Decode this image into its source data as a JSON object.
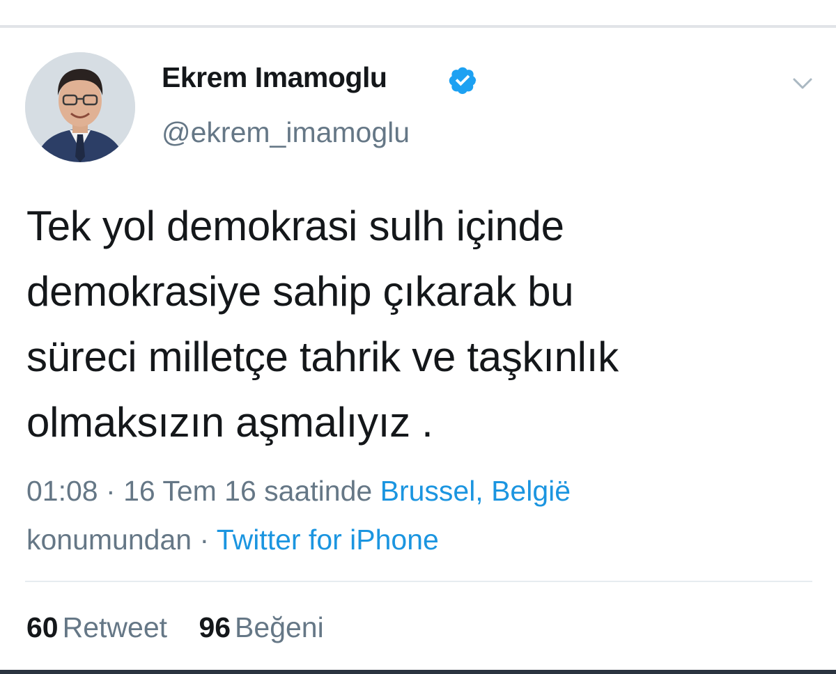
{
  "user": {
    "display_name": "Ekrem Imamoglu",
    "handle": "@ekrem_imamoglu",
    "verified": true
  },
  "tweet": {
    "text_lines": [
      "Tek yol demokrasi sulh içinde",
      "demokrasiye sahip çıkarak bu",
      "süreci milletçe tahrik ve taşkınlık",
      "olmaksızın aşmalıyız ."
    ],
    "time": "01:08",
    "separator": "·",
    "date": "16 Tem 16 saatinde",
    "location": "Brussel, België",
    "location_suffix": "konumundan",
    "source": "Twitter for iPhone"
  },
  "stats": {
    "retweets": "60",
    "retweets_label": "Retweet",
    "likes": "96",
    "likes_label": "Beğeni"
  },
  "colors": {
    "text": "#14171a",
    "secondary": "#657786",
    "link": "#1b95e0",
    "verified": "#1da1f2"
  },
  "icons": {
    "verified": "verified-badge-icon",
    "caret": "chevron-down-icon"
  }
}
